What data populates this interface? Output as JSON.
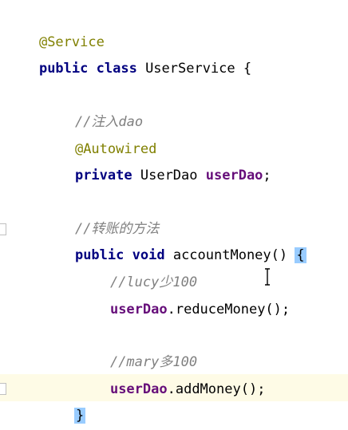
{
  "code": {
    "line1": {
      "annotation": "@Service"
    },
    "line2": {
      "kw1": "public",
      "kw2": "class",
      "classname": "UserService",
      "brace": "{"
    },
    "line3": {
      "comment": "//注入dao"
    },
    "line4": {
      "annotation": "@Autowired"
    },
    "line5": {
      "kw": "private",
      "type": "UserDao",
      "field": "userDao",
      "semi": ";"
    },
    "line6": {
      "comment": "//转账的方法"
    },
    "line7": {
      "kw1": "public",
      "kw2": "void",
      "method": "accountMoney",
      "parens": "()",
      "brace": "{"
    },
    "line8": {
      "comment": "//lucy少100"
    },
    "line9": {
      "field": "userDao",
      "call": ".reduceMoney()",
      "semi": ";"
    },
    "line10": {
      "comment": "//mary多100"
    },
    "line11": {
      "field": "userDao",
      "call": ".addMoney()",
      "semi": ";"
    },
    "line12": {
      "brace": "}"
    },
    "line13": {
      "brace": "}"
    }
  },
  "colors": {
    "annotation": "#808000",
    "keyword": "#000080",
    "field": "#660e7a",
    "comment": "#808080",
    "current_line": "#fefbe6",
    "brace_match": "#99ccff"
  }
}
